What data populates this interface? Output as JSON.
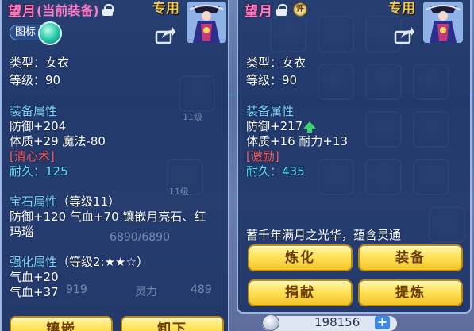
{
  "left_panel": {
    "name": "望月",
    "status": "(当前装备)",
    "exclusive": "专用",
    "toggle_label": "图标",
    "type_line": "类型：女衣",
    "level_line": "等级：90",
    "equip_attr_title": "装备属性",
    "defense": "防御+204",
    "stats": "体质+29 魔法-80",
    "effect": "[清心术]",
    "durability": "耐久：125",
    "gem_title": "宝石属性",
    "gem_level": "（等级11）",
    "gem_line1": "防御+120 气血+70 镶嵌月亮石、红",
    "gem_line2": "玛瑙",
    "enhance_title": "强化属性",
    "enhance_level": "（等级2:★★☆）",
    "enhance_line1": "气血+20",
    "enhance_line2": "气血+37",
    "buttons": {
      "inlay": "镶嵌",
      "unequip": "卸下"
    }
  },
  "right_panel": {
    "name": "望月",
    "badge": "评",
    "exclusive": "专用",
    "type_line": "类型：女衣",
    "level_line": "等级：90",
    "equip_attr_title": "装备属性",
    "defense": "防御+217",
    "stats": "体质+16 耐力+13",
    "effect": "[激励]",
    "durability": "耐久：435",
    "description": "蓄千年满月之光华，蕴含灵通",
    "buttons": {
      "refine": "炼化",
      "equip": "装备",
      "donate": "捐献",
      "extract": "提炼"
    }
  },
  "background": {
    "hp_text": "6890/6890",
    "stat_name": "灵力",
    "stat_value": "489",
    "left_value": "919",
    "level_tag_1": "11级",
    "level_tag_2": "11级"
  },
  "currency": {
    "value": "198156"
  },
  "icons": [
    "lock-icon",
    "share-icon",
    "portrait-icon",
    "upgrade-arrow-icon",
    "coin-icon",
    "plus-icon"
  ],
  "colors": {
    "name": "#ff79c6",
    "section": "#7ed3ff",
    "effect": "#ff5a5a",
    "durability": "#5fe3ff",
    "button": "#ffe35a"
  }
}
